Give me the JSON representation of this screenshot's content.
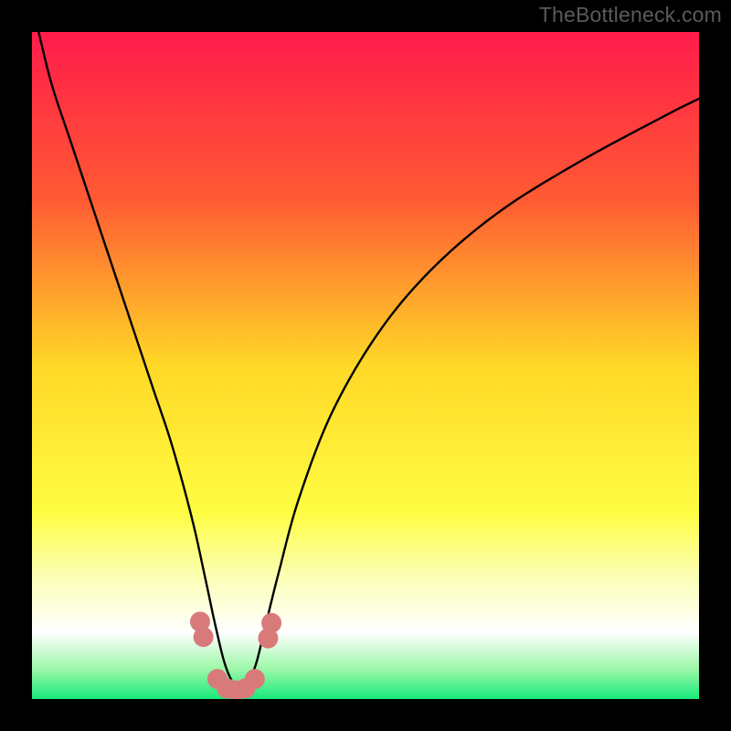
{
  "watermark": "TheBottleneck.com",
  "chart_data": {
    "type": "line",
    "title": "",
    "xlabel": "",
    "ylabel": "",
    "xlim": [
      0,
      100
    ],
    "ylim": [
      0,
      100
    ],
    "background_gradient": {
      "stops": [
        {
          "offset": 0.0,
          "color": "#ff1b4b"
        },
        {
          "offset": 0.25,
          "color": "#ff5a33"
        },
        {
          "offset": 0.5,
          "color": "#ffd827"
        },
        {
          "offset": 0.72,
          "color": "#fffd42"
        },
        {
          "offset": 0.82,
          "color": "#fbffb8"
        },
        {
          "offset": 0.9,
          "color": "#ffffff"
        },
        {
          "offset": 0.955,
          "color": "#9cf7a8"
        },
        {
          "offset": 1.0,
          "color": "#18ea7c"
        }
      ]
    },
    "series": [
      {
        "name": "bottleneck-curve",
        "description": "V-shaped curve descending from top-left, bottoming near x≈30, rising to upper-right",
        "x": [
          1,
          3,
          6,
          9,
          12,
          15,
          18,
          21,
          24,
          26,
          27.5,
          29,
          30.5,
          32,
          33.5,
          35,
          37,
          40,
          45,
          52,
          60,
          70,
          82,
          95,
          100
        ],
        "y": [
          100,
          92,
          83,
          74,
          65,
          56,
          47,
          38,
          27,
          18,
          11,
          5,
          2,
          2,
          5,
          11,
          19,
          30,
          43,
          55,
          64.5,
          73,
          80.5,
          87.5,
          90
        ]
      }
    ],
    "markers": {
      "name": "highlight-dots",
      "color": "#d97a7a",
      "points": [
        {
          "x": 25.2,
          "y": 11.6
        },
        {
          "x": 25.7,
          "y": 9.3
        },
        {
          "x": 27.8,
          "y": 3.0
        },
        {
          "x": 29.2,
          "y": 1.6
        },
        {
          "x": 30.6,
          "y": 1.3
        },
        {
          "x": 32.0,
          "y": 1.6
        },
        {
          "x": 33.4,
          "y": 3.0
        },
        {
          "x": 35.4,
          "y": 9.1
        },
        {
          "x": 35.9,
          "y": 11.4
        }
      ],
      "radius": 11
    }
  }
}
